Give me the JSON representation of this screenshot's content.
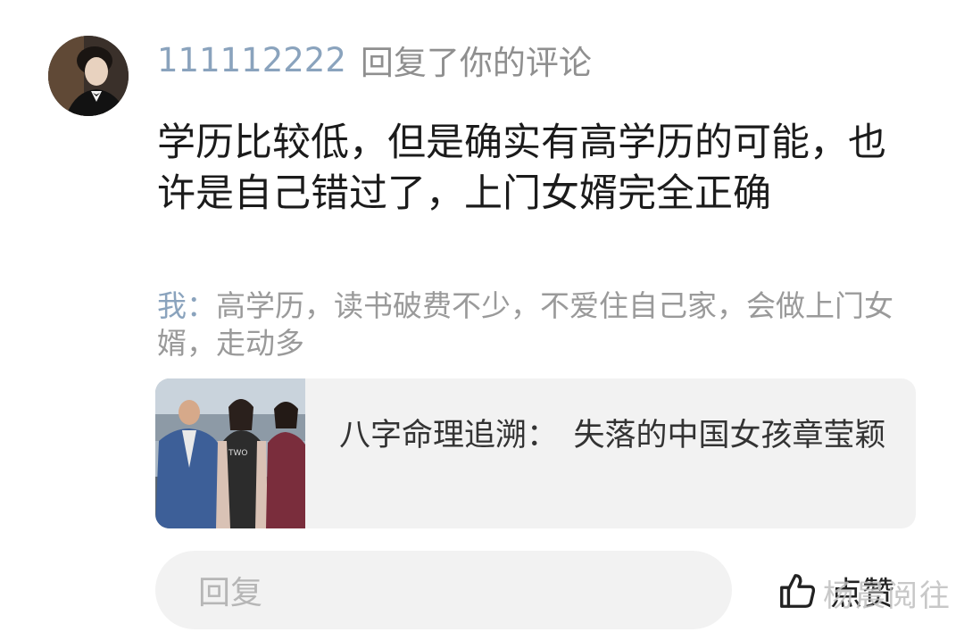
{
  "notification": {
    "username": "111112222",
    "action_text": "回复了你的评论",
    "comment_text": "学历比较低，但是确实有高学历的可能，也许是自己错过了，上门女婿完全正确",
    "quoted": {
      "author": "我：",
      "text": "高学历，读书破费不少，不爱住自己家，会做上门女婿，走动多"
    },
    "link_card": {
      "title": "八字命理追溯：　失落的中国女孩章莹颖"
    }
  },
  "footer": {
    "reply_placeholder": "回复",
    "like_label": "点赞",
    "like_icon": "thumbs-up-icon"
  },
  "watermark": "杨晨阅往",
  "colors": {
    "username": "#8aa3bd",
    "secondary_text": "#9a9a9a",
    "card_background": "#f2f2f2"
  }
}
